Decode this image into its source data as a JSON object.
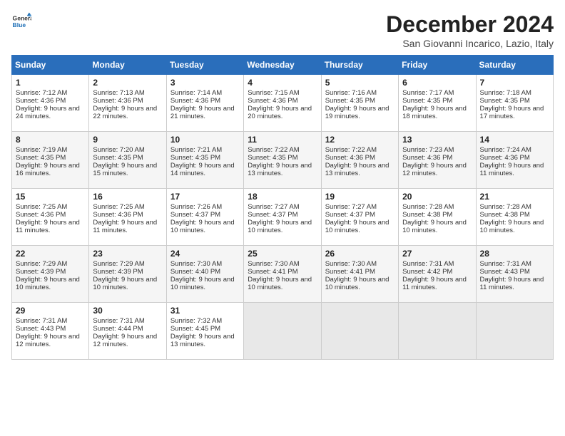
{
  "logo": {
    "line1": "General",
    "line2": "Blue"
  },
  "title": "December 2024",
  "subtitle": "San Giovanni Incarico, Lazio, Italy",
  "days_of_week": [
    "Sunday",
    "Monday",
    "Tuesday",
    "Wednesday",
    "Thursday",
    "Friday",
    "Saturday"
  ],
  "weeks": [
    [
      {
        "day": "1",
        "sunrise": "7:12 AM",
        "sunset": "4:36 PM",
        "daylight": "9 hours and 24 minutes."
      },
      {
        "day": "2",
        "sunrise": "7:13 AM",
        "sunset": "4:36 PM",
        "daylight": "9 hours and 22 minutes."
      },
      {
        "day": "3",
        "sunrise": "7:14 AM",
        "sunset": "4:36 PM",
        "daylight": "9 hours and 21 minutes."
      },
      {
        "day": "4",
        "sunrise": "7:15 AM",
        "sunset": "4:36 PM",
        "daylight": "9 hours and 20 minutes."
      },
      {
        "day": "5",
        "sunrise": "7:16 AM",
        "sunset": "4:35 PM",
        "daylight": "9 hours and 19 minutes."
      },
      {
        "day": "6",
        "sunrise": "7:17 AM",
        "sunset": "4:35 PM",
        "daylight": "9 hours and 18 minutes."
      },
      {
        "day": "7",
        "sunrise": "7:18 AM",
        "sunset": "4:35 PM",
        "daylight": "9 hours and 17 minutes."
      }
    ],
    [
      {
        "day": "8",
        "sunrise": "7:19 AM",
        "sunset": "4:35 PM",
        "daylight": "9 hours and 16 minutes."
      },
      {
        "day": "9",
        "sunrise": "7:20 AM",
        "sunset": "4:35 PM",
        "daylight": "9 hours and 15 minutes."
      },
      {
        "day": "10",
        "sunrise": "7:21 AM",
        "sunset": "4:35 PM",
        "daylight": "9 hours and 14 minutes."
      },
      {
        "day": "11",
        "sunrise": "7:22 AM",
        "sunset": "4:35 PM",
        "daylight": "9 hours and 13 minutes."
      },
      {
        "day": "12",
        "sunrise": "7:22 AM",
        "sunset": "4:36 PM",
        "daylight": "9 hours and 13 minutes."
      },
      {
        "day": "13",
        "sunrise": "7:23 AM",
        "sunset": "4:36 PM",
        "daylight": "9 hours and 12 minutes."
      },
      {
        "day": "14",
        "sunrise": "7:24 AM",
        "sunset": "4:36 PM",
        "daylight": "9 hours and 11 minutes."
      }
    ],
    [
      {
        "day": "15",
        "sunrise": "7:25 AM",
        "sunset": "4:36 PM",
        "daylight": "9 hours and 11 minutes."
      },
      {
        "day": "16",
        "sunrise": "7:25 AM",
        "sunset": "4:36 PM",
        "daylight": "9 hours and 11 minutes."
      },
      {
        "day": "17",
        "sunrise": "7:26 AM",
        "sunset": "4:37 PM",
        "daylight": "9 hours and 10 minutes."
      },
      {
        "day": "18",
        "sunrise": "7:27 AM",
        "sunset": "4:37 PM",
        "daylight": "9 hours and 10 minutes."
      },
      {
        "day": "19",
        "sunrise": "7:27 AM",
        "sunset": "4:37 PM",
        "daylight": "9 hours and 10 minutes."
      },
      {
        "day": "20",
        "sunrise": "7:28 AM",
        "sunset": "4:38 PM",
        "daylight": "9 hours and 10 minutes."
      },
      {
        "day": "21",
        "sunrise": "7:28 AM",
        "sunset": "4:38 PM",
        "daylight": "9 hours and 10 minutes."
      }
    ],
    [
      {
        "day": "22",
        "sunrise": "7:29 AM",
        "sunset": "4:39 PM",
        "daylight": "9 hours and 10 minutes."
      },
      {
        "day": "23",
        "sunrise": "7:29 AM",
        "sunset": "4:39 PM",
        "daylight": "9 hours and 10 minutes."
      },
      {
        "day": "24",
        "sunrise": "7:30 AM",
        "sunset": "4:40 PM",
        "daylight": "9 hours and 10 minutes."
      },
      {
        "day": "25",
        "sunrise": "7:30 AM",
        "sunset": "4:41 PM",
        "daylight": "9 hours and 10 minutes."
      },
      {
        "day": "26",
        "sunrise": "7:30 AM",
        "sunset": "4:41 PM",
        "daylight": "9 hours and 10 minutes."
      },
      {
        "day": "27",
        "sunrise": "7:31 AM",
        "sunset": "4:42 PM",
        "daylight": "9 hours and 11 minutes."
      },
      {
        "day": "28",
        "sunrise": "7:31 AM",
        "sunset": "4:43 PM",
        "daylight": "9 hours and 11 minutes."
      }
    ],
    [
      {
        "day": "29",
        "sunrise": "7:31 AM",
        "sunset": "4:43 PM",
        "daylight": "9 hours and 12 minutes."
      },
      {
        "day": "30",
        "sunrise": "7:31 AM",
        "sunset": "4:44 PM",
        "daylight": "9 hours and 12 minutes."
      },
      {
        "day": "31",
        "sunrise": "7:32 AM",
        "sunset": "4:45 PM",
        "daylight": "9 hours and 13 minutes."
      },
      null,
      null,
      null,
      null
    ]
  ]
}
